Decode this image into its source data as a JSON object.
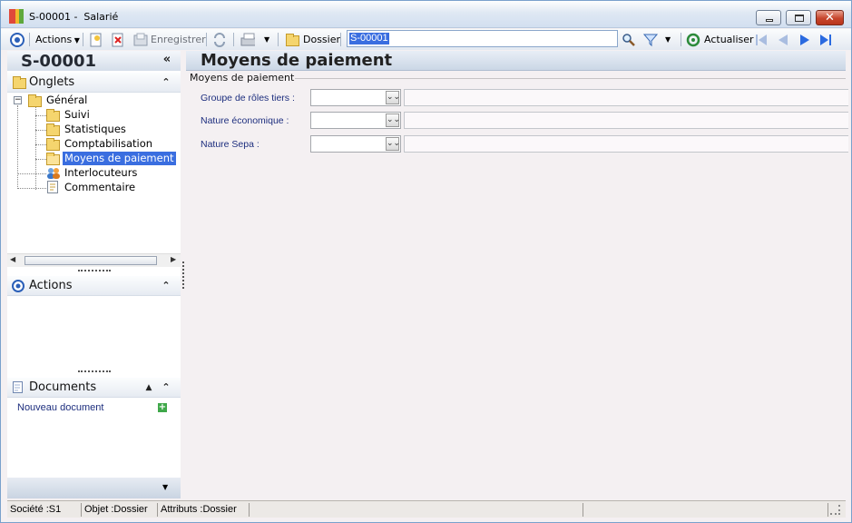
{
  "window": {
    "title": "S-00001 -  Salarié"
  },
  "toolbar": {
    "actions_label": "Actions",
    "save_label": "Enregistrer",
    "folder_label": "Dossier",
    "search_value": "S-00001",
    "refresh_label": "Actualiser"
  },
  "left_panel": {
    "record_id": "S-00001",
    "tabs_header": "Onglets",
    "tree": {
      "root": "Général",
      "children": [
        "Suivi",
        "Statistiques",
        "Comptabilisation",
        "Moyens de paiement"
      ],
      "others": [
        "Interlocuteurs",
        "Commentaire"
      ],
      "selected": "Moyens de paiement"
    },
    "actions_header": "Actions",
    "documents_header": "Documents",
    "new_document_label": "Nouveau document"
  },
  "main": {
    "page_title": "Moyens de paiement",
    "group_label": "Moyens de paiement",
    "fields": [
      {
        "label": "Groupe de rôles tiers :",
        "value": ""
      },
      {
        "label": "Nature économique :",
        "value": ""
      },
      {
        "label": "Nature Sepa :",
        "value": ""
      }
    ]
  },
  "statusbar": {
    "company": "Société :S1",
    "object": "Objet :Dossier",
    "attributes": "Attributs :Dossier"
  },
  "colors": {
    "selection": "#3a6ee0",
    "label_blue": "#1d2e7e",
    "close_red": "#c7452c"
  }
}
